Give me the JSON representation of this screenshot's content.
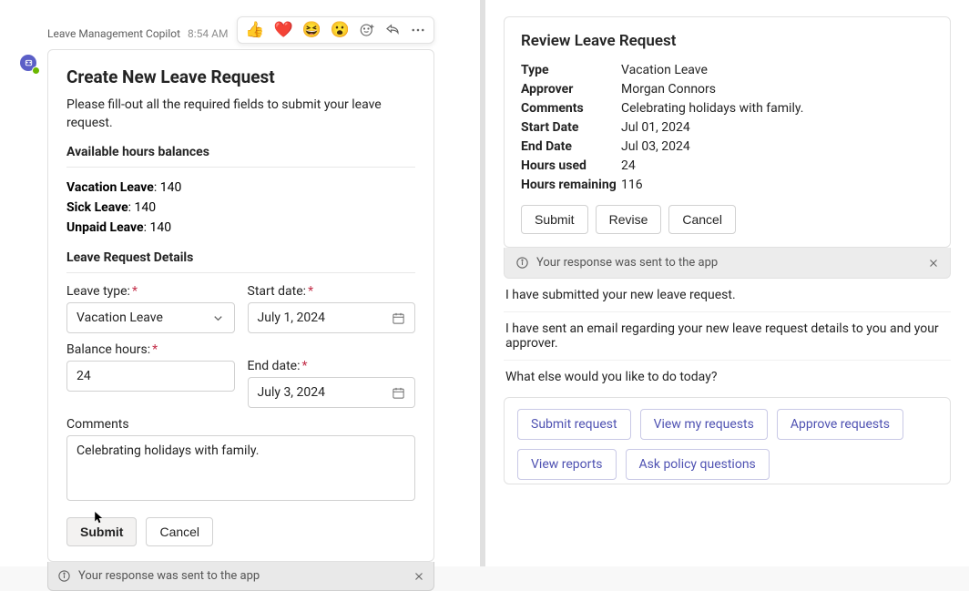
{
  "sender": "Leave Management Copilot",
  "timestamp": "8:54 AM",
  "create": {
    "title": "Create New Leave Request",
    "instruction": "Please fill-out all the required fields to submit your leave request.",
    "balances_header": "Available hours balances",
    "balances": [
      {
        "label": "Vacation Leave",
        "value": "140"
      },
      {
        "label": "Sick Leave",
        "value": "140"
      },
      {
        "label": "Unpaid Leave",
        "value": "140"
      }
    ],
    "details_header": "Leave Request Details",
    "leave_type_label": "Leave type:",
    "leave_type_value": "Vacation Leave",
    "start_date_label": "Start date:",
    "start_date_value": "July 1, 2024",
    "balance_hours_label": "Balance hours:",
    "balance_hours_value": "24",
    "end_date_label": "End date:",
    "end_date_value": "July 3, 2024",
    "comments_label": "Comments",
    "comments_value": "Celebrating holidays with family.",
    "submit": "Submit",
    "cancel": "Cancel",
    "status": "Your response was sent to the app"
  },
  "review": {
    "title": "Review Leave Request",
    "type_k": "Type",
    "type_v": "Vacation Leave",
    "approver_k": "Approver",
    "approver_v": "Morgan Connors",
    "comments_k": "Comments",
    "comments_v": "Celebrating holidays with family.",
    "start_k": "Start Date",
    "start_v": "Jul 01, 2024",
    "end_k": "End Date",
    "end_v": "Jul 03, 2024",
    "used_k": "Hours used",
    "used_v": "24",
    "remain_k": "Hours remaining",
    "remain_v": "116",
    "submit": "Submit",
    "revise": "Revise",
    "cancel": "Cancel",
    "status": "Your response was sent to the app"
  },
  "chat": {
    "line1": "I have submitted your new leave request.",
    "line2": "I have sent an email regarding your new leave request details to you and your approver.",
    "line3": "What else would you like to do today?"
  },
  "suggestions": {
    "s1": "Submit request",
    "s2": "View my requests",
    "s3": "Approve requests",
    "s4": "View reports",
    "s5": "Ask policy questions"
  }
}
